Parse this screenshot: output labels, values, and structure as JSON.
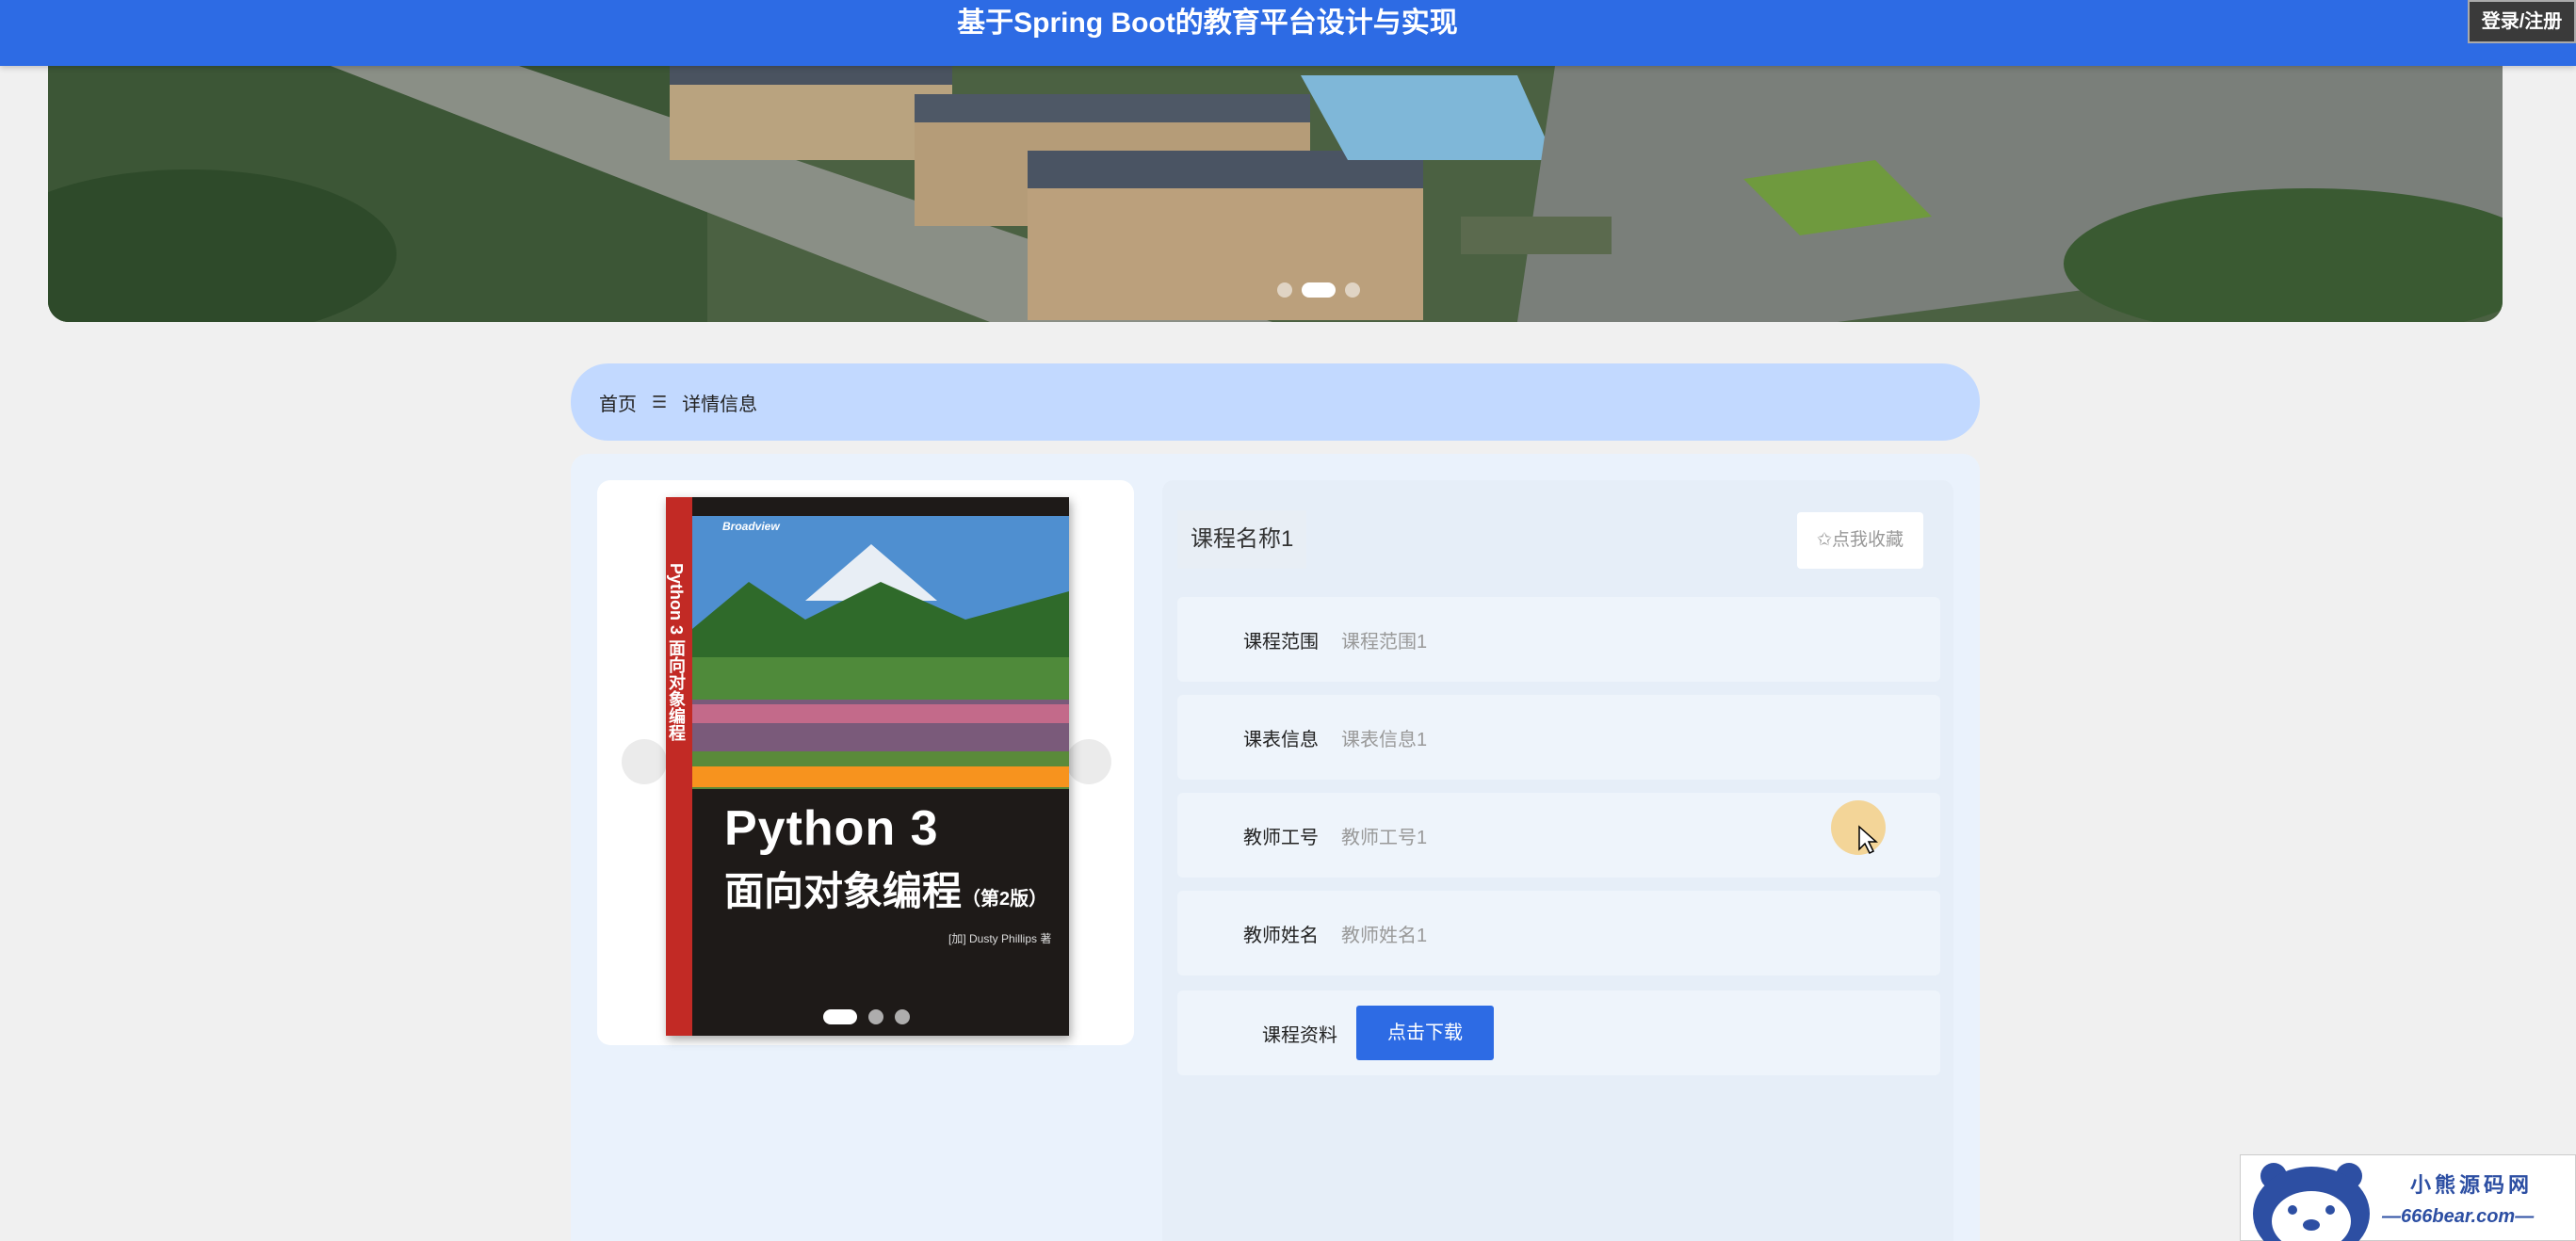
{
  "header": {
    "title": "基于Spring Boot的教育平台设计与实现",
    "login_label": "登录/注册",
    "color": "#2d6be4"
  },
  "banner": {
    "dots": 3,
    "active_dot": 2
  },
  "breadcrumb": {
    "home": "首页",
    "separator": "☰",
    "current": "详情信息"
  },
  "gallery": {
    "book": {
      "brand": "Broadview",
      "title": "Python 3",
      "subtitle": "面向对象编程",
      "edition": "（第2版）",
      "author": "[加] Dusty Phillips 著",
      "spine": "Python 3 面向对象编程"
    },
    "dots": 3,
    "active_dot": 1
  },
  "details": {
    "course_name": "课程名称1",
    "favorite_label": "✩点我收藏",
    "rows": [
      {
        "label": "课程范围",
        "value": "课程范围1"
      },
      {
        "label": "课表信息",
        "value": "课表信息1"
      },
      {
        "label": "教师工号",
        "value": "教师工号1"
      },
      {
        "label": "教师姓名",
        "value": "教师姓名1"
      }
    ],
    "download": {
      "label": "课程资料",
      "button": "点击下载"
    }
  },
  "watermark": {
    "name": "小熊源码网",
    "url": "—666bear.com—"
  }
}
